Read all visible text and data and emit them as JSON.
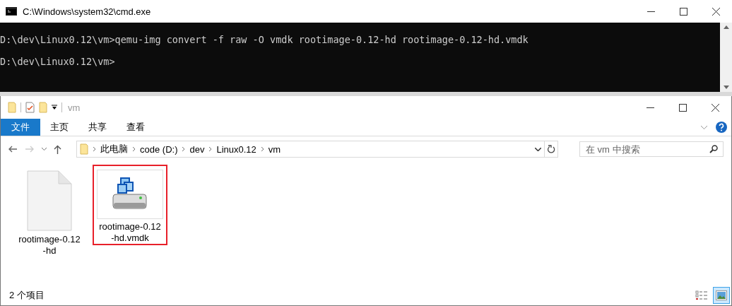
{
  "console_window": {
    "title": "C:\\Windows\\system32\\cmd.exe",
    "lines": [
      "D:\\dev\\Linux0.12\\vm>qemu-img convert -f raw -O vmdk rootimage-0.12-hd rootimage-0.12-hd.vmdk",
      "D:\\dev\\Linux0.12\\vm>"
    ]
  },
  "explorer_window": {
    "title": "vm",
    "ribbon_tabs": [
      {
        "label": "文件",
        "kind": "file"
      },
      {
        "label": "主页",
        "kind": "tab"
      },
      {
        "label": "共享",
        "kind": "tab"
      },
      {
        "label": "查看",
        "kind": "tab"
      }
    ],
    "breadcrumb": [
      "此电脑",
      "code (D:)",
      "dev",
      "Linux0.12",
      "vm"
    ],
    "search": {
      "placeholder": "在 vm 中搜索"
    },
    "files": [
      {
        "name": "rootimage-0.12\n-hd",
        "kind": "blank",
        "marked": false
      },
      {
        "name": "rootimage-0.12\n-hd.vmdk",
        "kind": "disk",
        "marked": true
      }
    ],
    "status_bar": {
      "item_count": "2 个项目",
      "views": [
        {
          "kind": "details",
          "selected": false
        },
        {
          "kind": "large-icons",
          "selected": true
        }
      ]
    }
  }
}
